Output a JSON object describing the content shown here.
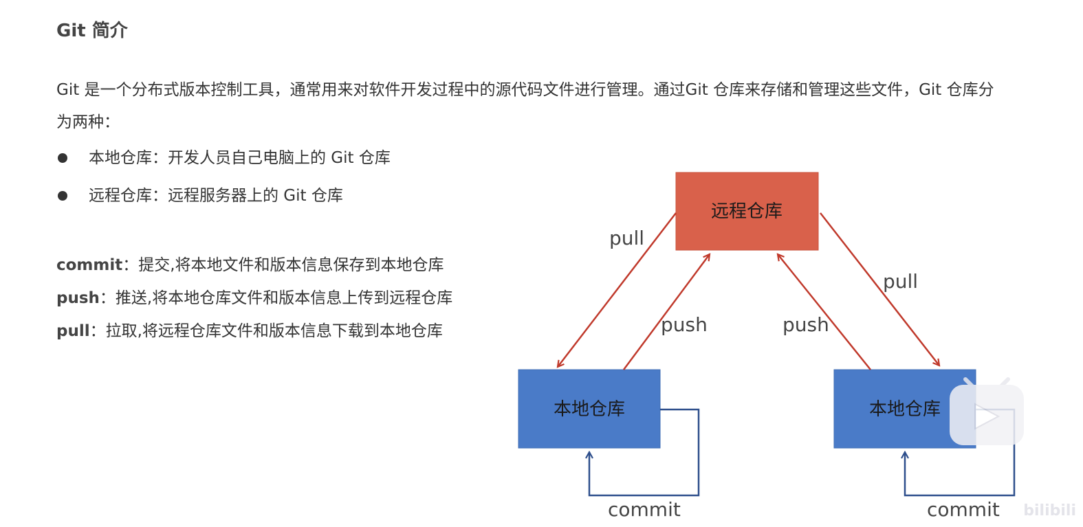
{
  "header": {
    "title": "Git 简介"
  },
  "intro": {
    "text": "Git 是一个分布式版本控制工具，通常用来对软件开发过程中的源代码文件进行管理。通过Git 仓库来存储和管理这些文件，Git 仓库分为两种："
  },
  "bullets": [
    {
      "text": "本地仓库：开发人员自己电脑上的 Git 仓库"
    },
    {
      "text": "远程仓库：远程服务器上的 Git 仓库"
    }
  ],
  "definitions": [
    {
      "term": "commit",
      "desc": "：提交,将本地文件和版本信息保存到本地仓库"
    },
    {
      "term": "push",
      "desc": "：推送,将本地仓库文件和版本信息上传到远程仓库"
    },
    {
      "term": "pull",
      "desc": "：拉取,将远程仓库文件和版本信息下载到本地仓库"
    }
  ],
  "diagram": {
    "remote_label": "远程仓库",
    "local_left_label": "本地仓库",
    "local_right_label": "本地仓库",
    "edges": {
      "pull_left": "pull",
      "push_left": "push",
      "push_right": "push",
      "pull_right": "pull",
      "commit_left": "commit",
      "commit_right": "commit"
    },
    "colors": {
      "remote_fill": "#d9614b",
      "local_fill": "#4a7bc8",
      "remote_arrow": "#c0392b",
      "commit_arrow": "#2e4f8c"
    }
  },
  "watermark": {
    "text": "bilibili",
    "icon": "bilibili-play-icon"
  }
}
